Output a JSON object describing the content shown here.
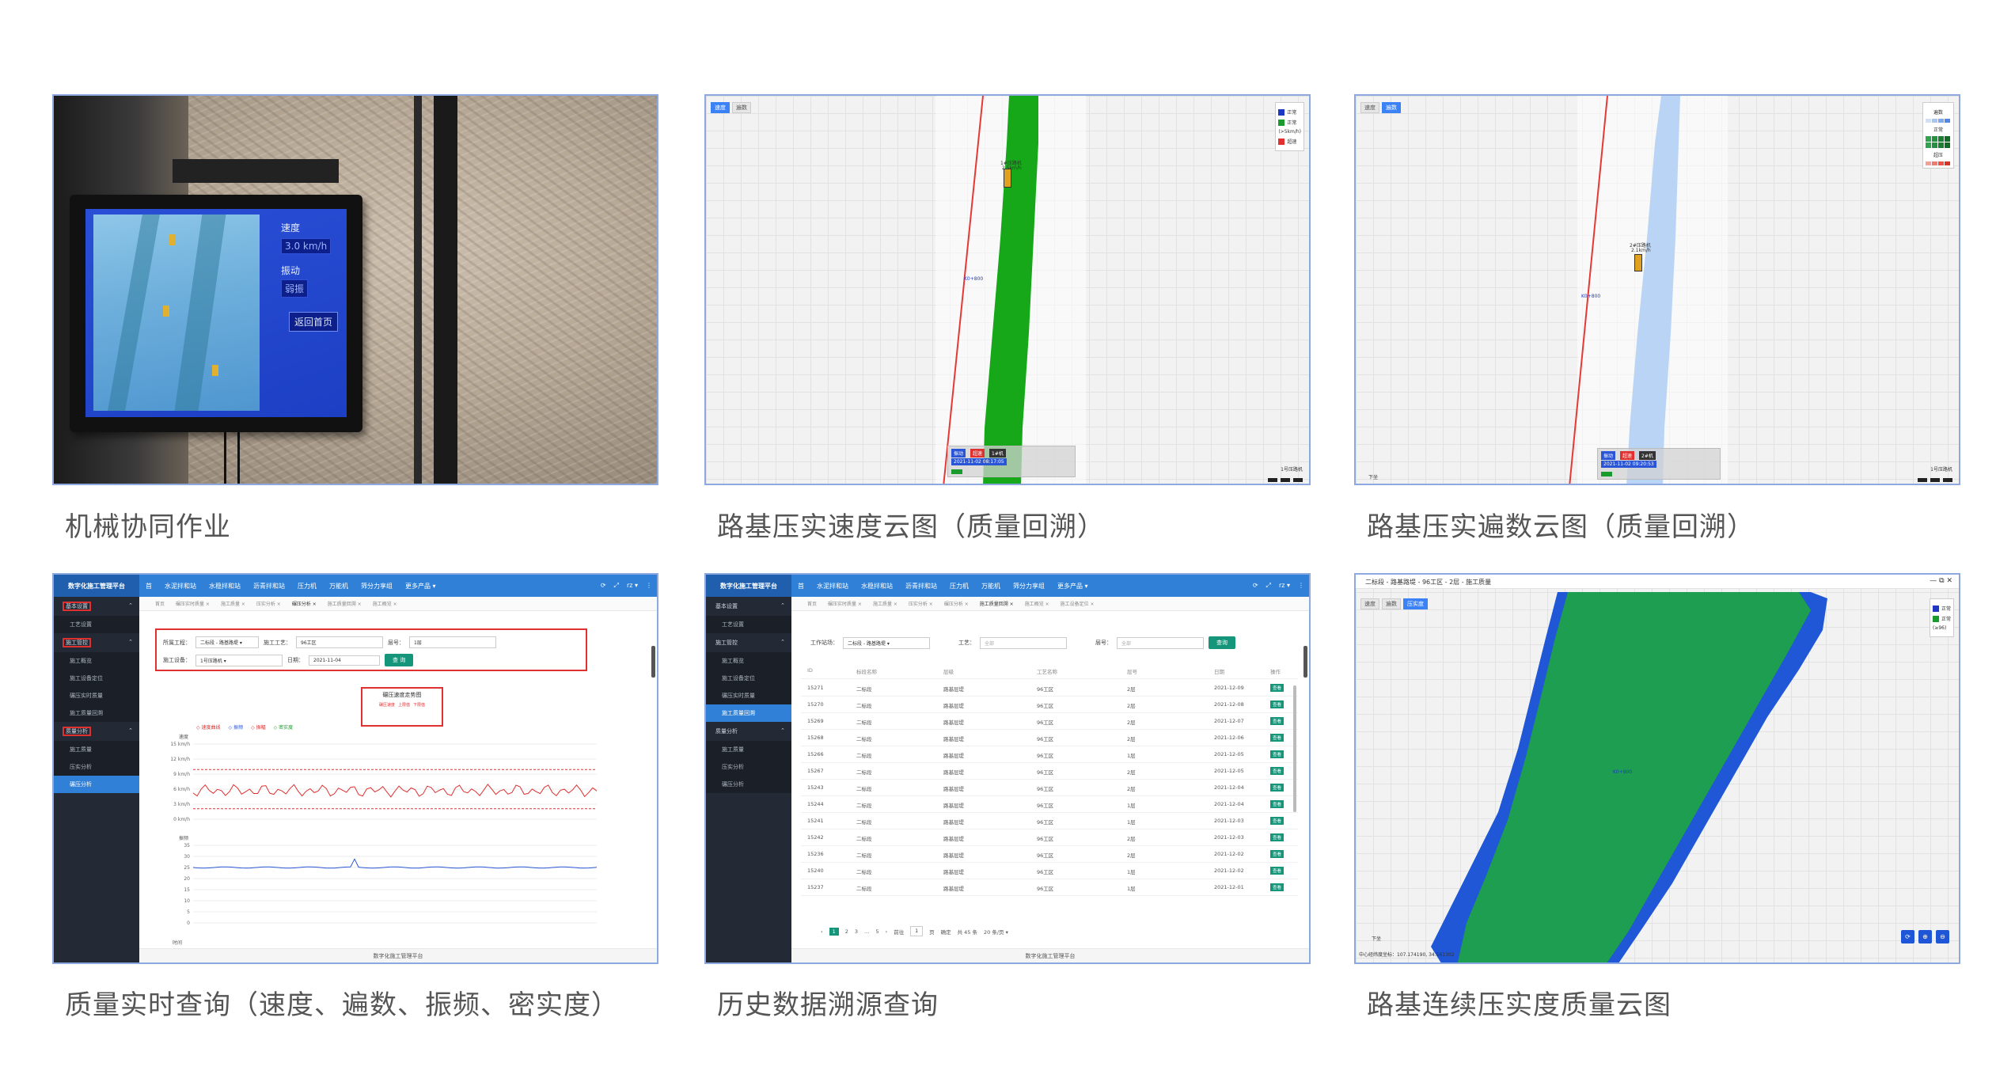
{
  "captions": [
    "机械协同作业",
    "路基压实速度云图（质量回溯）",
    "路基压实遍数云图（质量回溯）",
    "质量实时查询（速度、遍数、振频、密实度）",
    "历史数据溯源查询",
    "路基连续压实度质量云图"
  ],
  "tile1": {
    "labels": [
      "速度",
      "振动"
    ],
    "values": [
      "3.0 km/h",
      "弱振"
    ],
    "button": "返回首页"
  },
  "tile2": {
    "tabs": [
      "速度",
      "遍数"
    ],
    "legend": [
      "正常",
      "正常",
      "超速"
    ],
    "legend_sub": "(>5km/h)",
    "machine": "1#压路机",
    "machine_speed": "2.5km/h",
    "coord_label": "K0+800",
    "chips": [
      "振动",
      "超速",
      "1#机"
    ],
    "time": "2021-11-02 08:17:05",
    "corner": "1号压路机",
    "colors": {
      "road": "#17a81a",
      "legend_blue": "#1d39c4",
      "legend_green": "#1a9b2e",
      "legend_red": "#e23030"
    }
  },
  "tile3": {
    "tabs": [
      "速度",
      "遍数"
    ],
    "legend_groups": [
      "遍数",
      "正常",
      "超压"
    ],
    "machine": "2#压路机",
    "machine_speed": "2.1km/h",
    "coord_label": "K0+800",
    "chips": [
      "振动",
      "超速",
      "2#机"
    ],
    "time": "2021-11-02 09:20:53",
    "corner_left": "下坐",
    "corner": "1号压路机",
    "colors": {
      "road": "#b9d4f5"
    }
  },
  "tile4": {
    "brand": "数字化施工管理平台",
    "nav": [
      "首",
      "水泥拌和站",
      "水稳拌和站",
      "沥青拌和站",
      "压力机",
      "万能机",
      "筛分力享组",
      "更多产品 ▾"
    ],
    "top_right": [
      "⟳",
      "⤢",
      "rz ▾",
      "⋮"
    ],
    "sidebar": [
      {
        "label": "基本设置",
        "boxed": true,
        "subs": [
          "工艺设置"
        ]
      },
      {
        "label": "施工管控",
        "boxed": true,
        "subs": [
          "施工概览",
          "施工设备定位",
          "碾压实时质量",
          "施工质量回溯"
        ]
      },
      {
        "label": "质量分析",
        "boxed": true,
        "subs": [
          "施工质量",
          "压实分析",
          "碾压分析"
        ]
      }
    ],
    "active_sub": "碾压分析",
    "tabs": [
      "首页",
      "碾压实时质量 ×",
      "施工质量 ×",
      "压实分析 ×",
      "碾压分析 ×",
      "施工质量回溯 ×",
      "施工概览 ×"
    ],
    "filters": {
      "project_label": "所属工程：",
      "project_value": "二标段 - 路基路堤 ▾",
      "process_label": "施工工艺：",
      "process_value": "96工区",
      "layer_label": "层号：",
      "layer_value": "1层",
      "device_label": "施工设备：",
      "device_value": "1号压路机 ▾",
      "date_label": "日期：",
      "date_value": "2021-11-04",
      "query": "查 询"
    },
    "chart_title": "碾压速度走势图",
    "chart_legend_inner": [
      "碾压速度",
      "上限值",
      "下限值"
    ],
    "chart_legend": [
      "速度曲线",
      "振频",
      "振幅",
      "密实度"
    ],
    "speed_axis": [
      "15 km/h",
      "12 km/h",
      "9 km/h",
      "6 km/h",
      "3 km/h",
      "0 km/h"
    ],
    "speed_axis_title": "速度",
    "freq_axis_title": "振频",
    "freq_axis": [
      "35",
      "30",
      "25",
      "20",
      "15",
      "10",
      "5",
      "0"
    ],
    "x_axis_last": "时间",
    "footer": "数字化施工管理平台"
  },
  "tile5": {
    "brand": "数字化施工管理平台",
    "nav": [
      "首",
      "水泥拌和站",
      "水稳拌和站",
      "沥青拌和站",
      "压力机",
      "万能机",
      "筛分力享组",
      "更多产品 ▾"
    ],
    "top_right": [
      "⟳",
      "⤢",
      "rz ▾",
      "⋮"
    ],
    "sidebar": [
      {
        "label": "基本设置",
        "subs": [
          "工艺设置"
        ]
      },
      {
        "label": "施工管控",
        "subs": [
          "施工概览",
          "施工设备定位",
          "碾压实时质量",
          "施工质量回溯"
        ]
      },
      {
        "label": "质量分析",
        "subs": [
          "施工质量",
          "压实分析",
          "碾压分析"
        ]
      }
    ],
    "active_sub": "施工质量回溯",
    "tabs": [
      "首页",
      "碾压实时质量 ×",
      "施工质量 ×",
      "压实分析 ×",
      "碾压分析 ×",
      "施工质量回溯 ×",
      "施工概览 ×",
      "施工设备定位 ×"
    ],
    "filters": {
      "project_label": "工作站场：",
      "project_value": "二标段 - 路基路堤 ▾",
      "process_label": "工艺：",
      "process_value": "全部",
      "layer_label": "层号：",
      "layer_value": "全部",
      "query": "查询"
    },
    "columns": [
      "ID",
      "标段名称",
      "层级",
      "工艺名称",
      "层号",
      "日期",
      "操作"
    ],
    "rows": [
      [
        "15271",
        "二标段",
        "路基层堤",
        "96工区",
        "2层",
        "2021-12-09",
        "查看"
      ],
      [
        "15270",
        "二标段",
        "路基层堤",
        "96工区",
        "2层",
        "2021-12-08",
        "查看"
      ],
      [
        "15269",
        "二标段",
        "路基层堤",
        "96工区",
        "2层",
        "2021-12-07",
        "查看"
      ],
      [
        "15268",
        "二标段",
        "路基层堤",
        "96工区",
        "2层",
        "2021-12-06",
        "查看"
      ],
      [
        "15266",
        "二标段",
        "路基层堤",
        "96工区",
        "1层",
        "2021-12-05",
        "查看"
      ],
      [
        "15267",
        "二标段",
        "路基层堤",
        "96工区",
        "2层",
        "2021-12-05",
        "查看"
      ],
      [
        "15243",
        "二标段",
        "路基层堤",
        "96工区",
        "2层",
        "2021-12-04",
        "查看"
      ],
      [
        "15244",
        "二标段",
        "路基层堤",
        "96工区",
        "1层",
        "2021-12-04",
        "查看"
      ],
      [
        "15241",
        "二标段",
        "路基层堤",
        "96工区",
        "1层",
        "2021-12-03",
        "查看"
      ],
      [
        "15242",
        "二标段",
        "路基层堤",
        "96工区",
        "2层",
        "2021-12-03",
        "查看"
      ],
      [
        "15236",
        "二标段",
        "路基层堤",
        "96工区",
        "2层",
        "2021-12-02",
        "查看"
      ],
      [
        "15240",
        "二标段",
        "路基层堤",
        "96工区",
        "1层",
        "2021-12-02",
        "查看"
      ],
      [
        "15237",
        "二标段",
        "路基层堤",
        "96工区",
        "1层",
        "2021-12-01",
        "查看"
      ]
    ],
    "pager": {
      "pages": [
        "1",
        "2",
        "3",
        "…",
        "5"
      ],
      "next": "前往",
      "page_val": "1",
      "unit": "页",
      "total": "共 45 条",
      "size": "20 条/页 ▾",
      "confirm": "确定"
    },
    "footer": "数字化施工管理平台"
  },
  "tile6": {
    "title": "二标段 - 路基路堤 - 96工区 - 2层 - 施工质量",
    "win_controls": "— ⧉ ✕",
    "tabs": [
      "速度",
      "遍数",
      "压实度"
    ],
    "legend": [
      "正常",
      "正常",
      "(≥96)"
    ],
    "center_label": "K0+800",
    "corner": "下坐",
    "coords": "中心经纬度坐标：107.174190, 34.561302",
    "ctrl": [
      "⟳",
      "⊕",
      "⊖"
    ],
    "colors": {
      "fill": "#1e9e50",
      "edge": "#1f57d6"
    }
  }
}
